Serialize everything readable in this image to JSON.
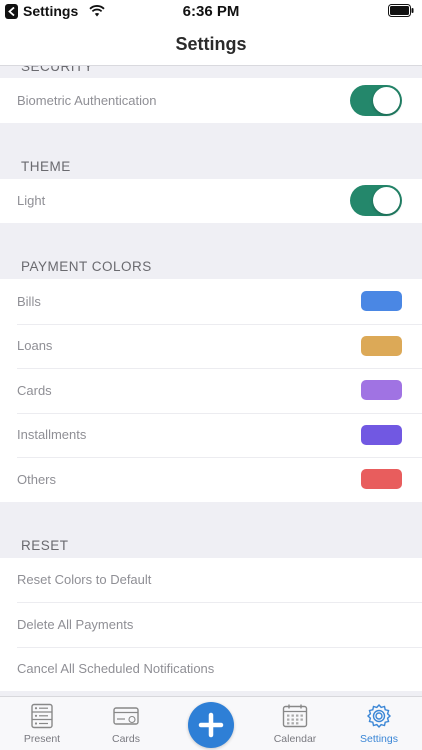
{
  "status_bar": {
    "app_name": "Settings",
    "time": "6:36 PM"
  },
  "nav": {
    "title": "Settings"
  },
  "sections": {
    "security": {
      "header": "SECURITY",
      "biometric_label": "Biometric Authentication",
      "biometric_on": true
    },
    "theme": {
      "header": "THEME",
      "light_label": "Light",
      "light_on": true
    },
    "payment_colors": {
      "header": "PAYMENT COLORS",
      "items": [
        {
          "label": "Bills",
          "color": "#4a87e4"
        },
        {
          "label": "Loans",
          "color": "#dca957"
        },
        {
          "label": "Cards",
          "color": "#a073e3"
        },
        {
          "label": "Installments",
          "color": "#7158e2"
        },
        {
          "label": "Others",
          "color": "#e85d5d"
        }
      ]
    },
    "reset": {
      "header": "RESET",
      "items": [
        {
          "label": "Reset Colors to Default"
        },
        {
          "label": "Delete All Payments"
        },
        {
          "label": "Cancel All Scheduled Notifications"
        }
      ]
    }
  },
  "tab_bar": {
    "tabs": [
      {
        "label": "Present",
        "icon": "server-list-icon"
      },
      {
        "label": "Cards",
        "icon": "credit-card-icon"
      },
      {
        "label": "Calendar",
        "icon": "calendar-icon"
      },
      {
        "label": "Settings",
        "icon": "gear-icon",
        "active": true
      }
    ],
    "add_icon": "plus-icon"
  },
  "colors": {
    "toggle_on": "#24876b",
    "accent": "#2e7fd6"
  }
}
